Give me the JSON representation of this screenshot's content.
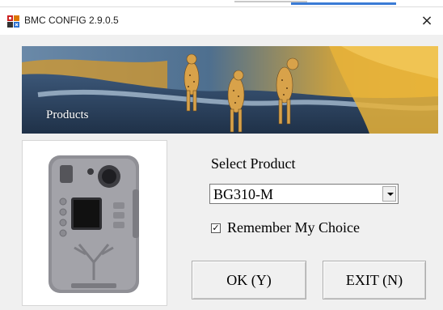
{
  "window": {
    "title": "BMC CONFIG 2.9.0.5",
    "close_glyph": "×",
    "icon": "bmc-app-icon"
  },
  "banner": {
    "label": "Products",
    "image": "cheetahs-on-road-photo"
  },
  "product_image": "trail-camera-photo",
  "form": {
    "select_label": "Select Product",
    "selected_product": "BG310-M",
    "remember_checked": true,
    "remember_label": "Remember My Choice",
    "check_glyph": "✓"
  },
  "buttons": {
    "ok_label": "OK (Y)",
    "exit_label": "EXIT (N)"
  }
}
